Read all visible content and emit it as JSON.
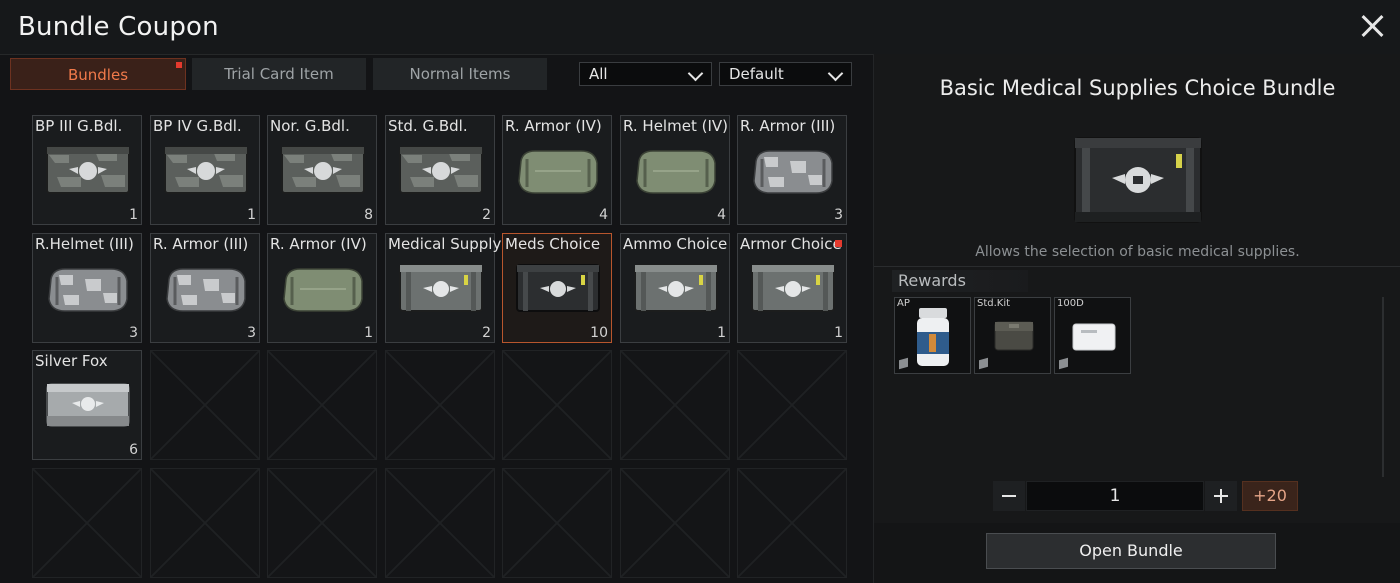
{
  "window": {
    "title": "Bundle Coupon",
    "close_icon": "close-icon"
  },
  "tabs": [
    {
      "label": "Bundles",
      "active": true,
      "has_badge": true
    },
    {
      "label": "Trial Card Item",
      "active": false
    },
    {
      "label": "Normal Items",
      "active": false
    }
  ],
  "filters": {
    "category": "All",
    "sort": "Default"
  },
  "items": [
    {
      "label": "BP III G.Bdl.",
      "count": "1",
      "icon": "crate-camo-icon"
    },
    {
      "label": "BP IV G.Bdl.",
      "count": "1",
      "icon": "crate-camo-icon"
    },
    {
      "label": "Nor. G.Bdl.",
      "count": "8",
      "icon": "crate-camo-icon"
    },
    {
      "label": "Std. G.Bdl.",
      "count": "2",
      "icon": "crate-camo-icon"
    },
    {
      "label": "R. Armor (IV)",
      "count": "4",
      "icon": "duffel-green-icon"
    },
    {
      "label": "R. Helmet (IV)",
      "count": "4",
      "icon": "duffel-green-icon"
    },
    {
      "label": "R. Armor (III)",
      "count": "3",
      "icon": "duffel-grey-icon"
    },
    {
      "label": "R.Helmet (III)",
      "count": "3",
      "icon": "duffel-grey-icon"
    },
    {
      "label": "R. Armor (III)",
      "count": "3",
      "icon": "duffel-grey-icon"
    },
    {
      "label": "R. Armor (IV)",
      "count": "1",
      "icon": "duffel-green-icon"
    },
    {
      "label": "Medical Supply",
      "count": "2",
      "icon": "crate-grey-icon"
    },
    {
      "label": "Meds Choice",
      "count": "10",
      "icon": "crate-black-icon",
      "selected": true
    },
    {
      "label": "Ammo Choice",
      "count": "1",
      "icon": "crate-grey-icon"
    },
    {
      "label": "Armor Choice",
      "count": "1",
      "icon": "crate-grey-icon",
      "has_badge": true
    },
    {
      "label": "Silver Fox",
      "count": "6",
      "icon": "case-silver-icon"
    }
  ],
  "detail": {
    "title": "Basic Medical Supplies Choice Bundle",
    "description": "Allows the selection of basic medical supplies.",
    "rewards_label": "Rewards",
    "rewards": [
      {
        "label": "AP",
        "icon": "pill-bottle-icon"
      },
      {
        "label": "Std.Kit",
        "icon": "med-pouch-icon"
      },
      {
        "label": "100D",
        "icon": "bandage-icon"
      }
    ],
    "quantity": "1",
    "plus20_label": "+20",
    "open_label": "Open Bundle"
  }
}
